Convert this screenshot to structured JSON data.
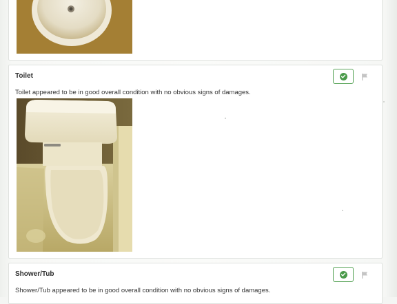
{
  "sections": {
    "toilet": {
      "title": "Toilet",
      "description": "Toilet appeared to be in good overall condition with no obvious signs of damages."
    },
    "shower_tub": {
      "title": "Shower/Tub",
      "description": "Shower/Tub appeared to be in good overall condition with no obvious signs of damages."
    }
  },
  "icons": {
    "status_ok": "check-circle-icon",
    "flag": "flag-icon"
  },
  "colors": {
    "ok_green": "#4a9a4a",
    "flag_gray": "#c4c4c4"
  }
}
